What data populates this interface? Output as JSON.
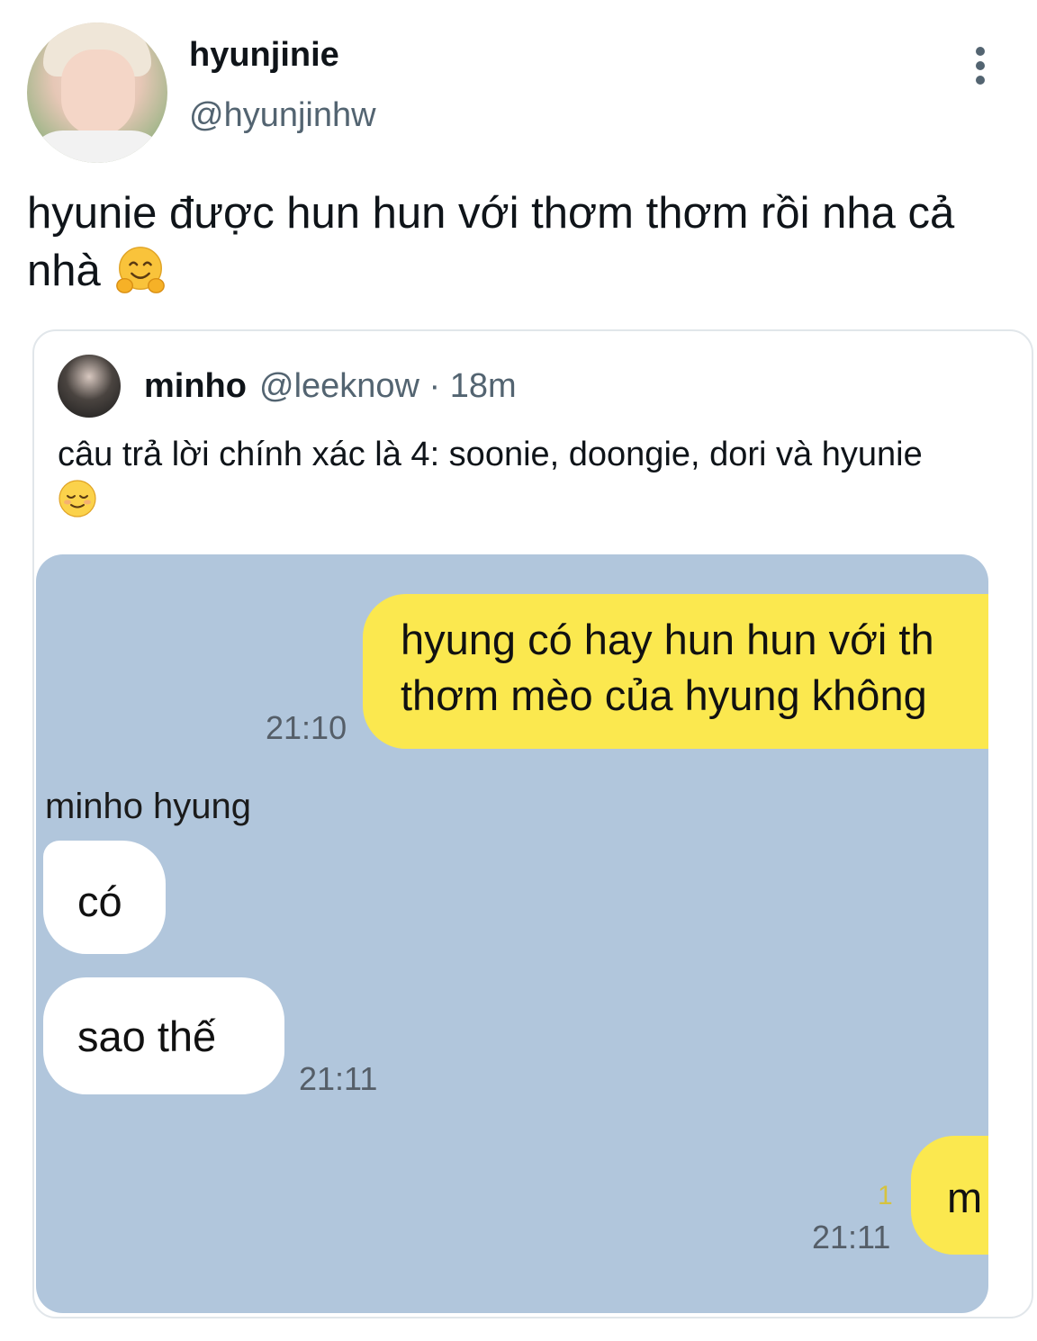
{
  "author": {
    "display_name": "hyunjinie",
    "handle": "@hyunjinhw"
  },
  "tweet": {
    "text": "hyunie được hun hun với thơm thơm rồi nha cả nhà",
    "emoji": "hugging-face"
  },
  "quoted_tweet": {
    "display_name": "minho",
    "meta": "@leeknow · 18m",
    "text": "câu trả lời chính xác là 4: soonie, doongie, dori và hyunie",
    "emoji": "relieved-face",
    "chat": {
      "outgoing_1": {
        "line1": "hyung có hay hun hun với th",
        "line2": "thơm mèo của hyung không",
        "time": "21:10"
      },
      "sender_name": "minho hyung",
      "incoming_1": "có",
      "incoming_2": "sao thế",
      "incoming_time": "21:11",
      "outgoing_2": {
        "text": "m",
        "read_count": "1",
        "time": "21:11"
      }
    }
  },
  "colors": {
    "chat_background": "#b1c6dc",
    "outgoing_bubble": "#fbe84f",
    "incoming_bubble": "#ffffff",
    "secondary_text": "#536471"
  }
}
